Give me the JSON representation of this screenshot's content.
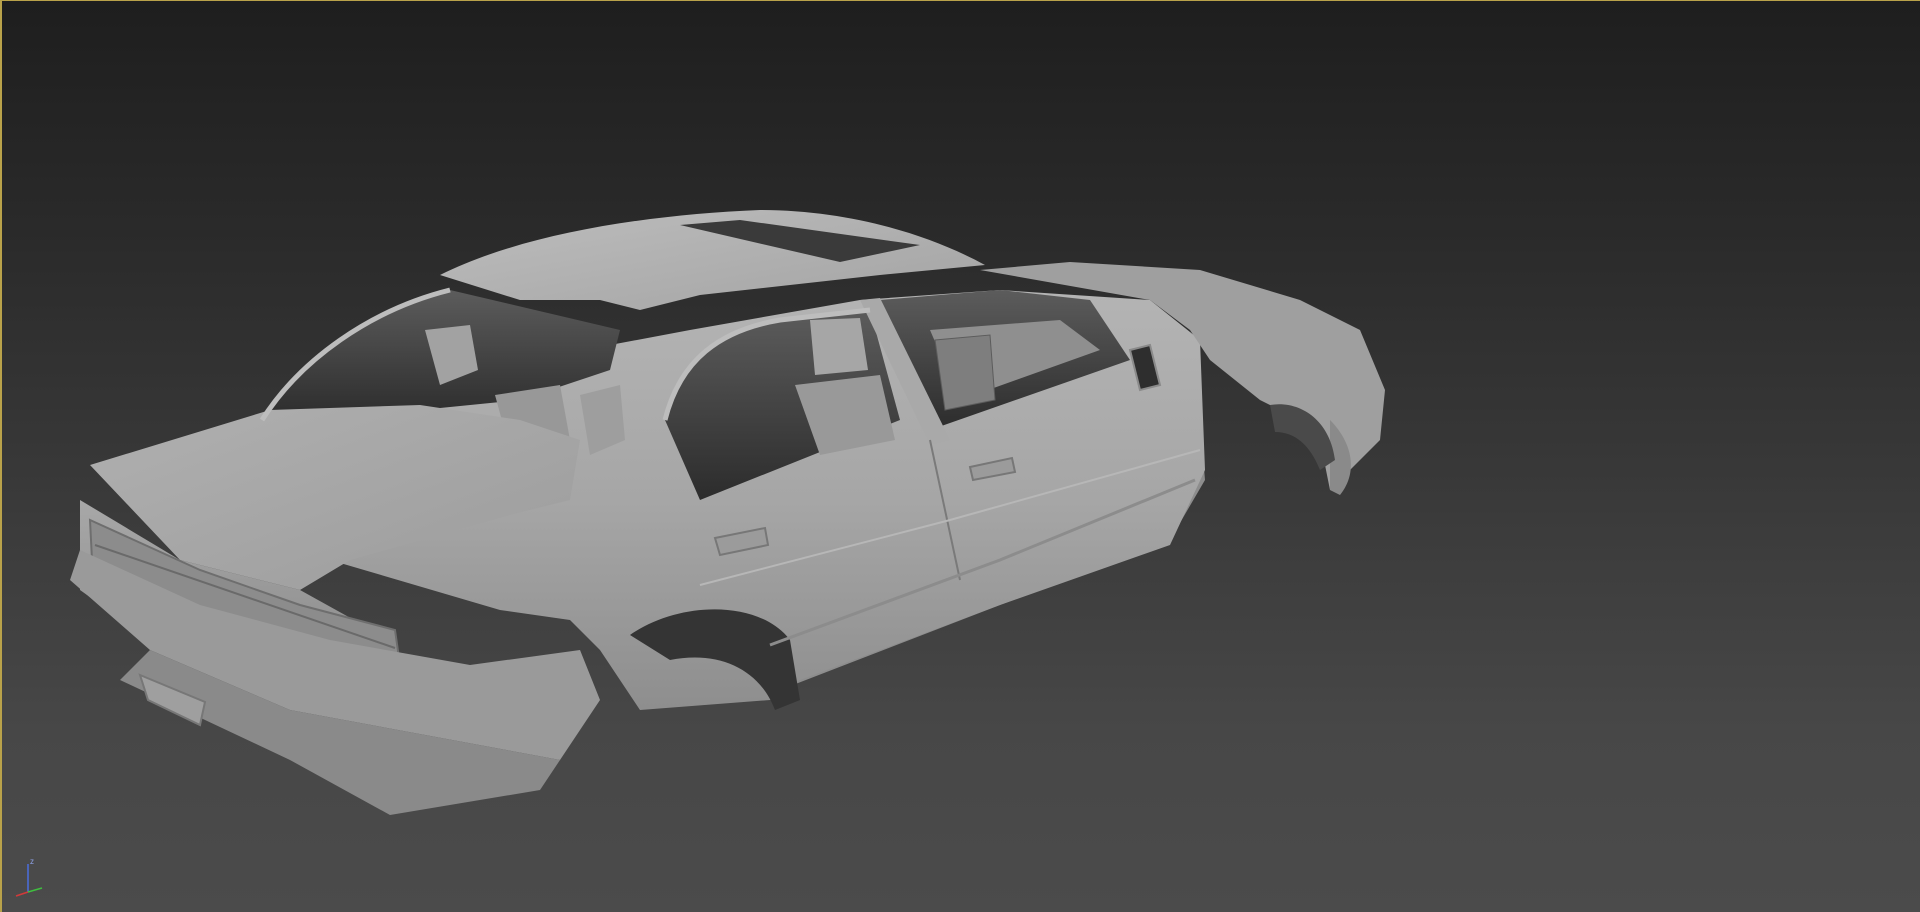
{
  "viewport": {
    "view_mode": "perspective",
    "shading": "clay",
    "background_top": "#1e1e1e",
    "background_bottom": "#4b4b4b",
    "active_border_color": "#b9a24a"
  },
  "model": {
    "icon": "sedan-body-shell",
    "material_color": "#a9a9a9"
  },
  "gizmo": {
    "x_label": "",
    "y_label": "",
    "z_label": "z",
    "x_color": "#d23a3a",
    "y_color": "#3fbf3f",
    "z_color": "#4a6ee0"
  }
}
